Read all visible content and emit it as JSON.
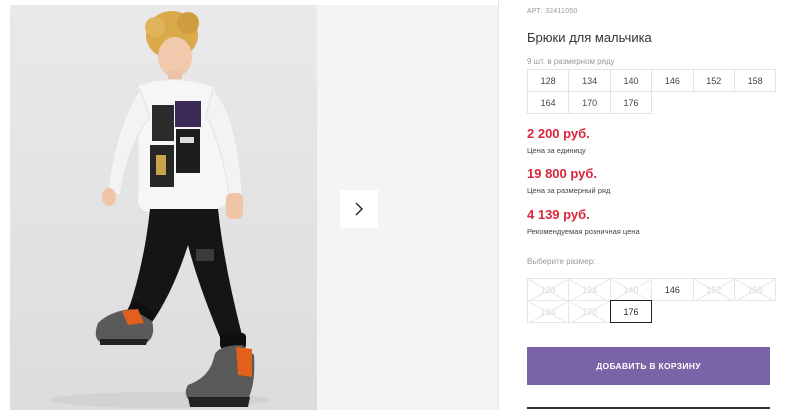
{
  "gallery": {
    "next_icon": "chevron-right-icon"
  },
  "product": {
    "article": "АРТ: 32411050",
    "title": "Брюки для мальчика",
    "pack_label": "9 шт. в размерном ряду",
    "pack_sizes": [
      "128",
      "134",
      "140",
      "146",
      "152",
      "158",
      "164",
      "170",
      "176"
    ],
    "prices": [
      {
        "value": "2 200 руб.",
        "label": "Цена за единицу"
      },
      {
        "value": "19 800 руб.",
        "label": "Цена за размерный ряд"
      },
      {
        "value": "4 139 руб.",
        "label": "Рекомендуемая розничная цена"
      }
    ],
    "choose_label": "Выберите размер:",
    "choose_sizes": [
      {
        "label": "128",
        "state": "disabled"
      },
      {
        "label": "134",
        "state": "disabled"
      },
      {
        "label": "140",
        "state": "disabled"
      },
      {
        "label": "146",
        "state": "available"
      },
      {
        "label": "152",
        "state": "disabled"
      },
      {
        "label": "158",
        "state": "disabled"
      },
      {
        "label": "164",
        "state": "disabled"
      },
      {
        "label": "170",
        "state": "disabled"
      },
      {
        "label": "176",
        "state": "selected"
      }
    ],
    "add_to_cart": "ДОБАВИТЬ В КОРЗИНУ"
  },
  "colors": {
    "price": "#d9263a",
    "button": "#7a63a6",
    "page_bg": "#ffffff",
    "photo_bg": "#e6e6e6"
  }
}
